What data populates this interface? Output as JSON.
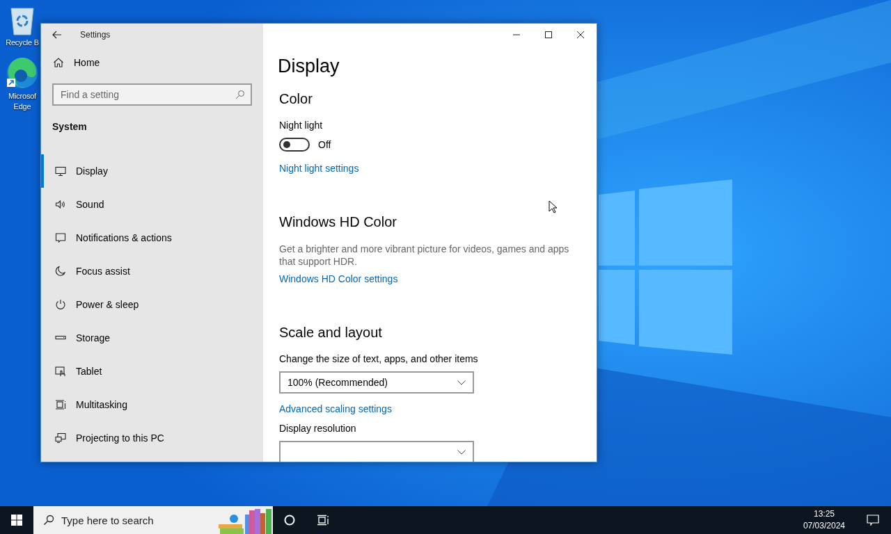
{
  "desktop_icons": [
    {
      "kind": "bin",
      "lines": [
        "Recycle B"
      ]
    },
    {
      "kind": "edge",
      "lines": [
        "Microsof",
        "Edge"
      ]
    }
  ],
  "window": {
    "title": "Settings",
    "home": "Home",
    "search": {
      "placeholder": "Find a setting"
    },
    "section": "System",
    "nav": [
      {
        "kind": "display",
        "label": "Display",
        "selected": true
      },
      {
        "kind": "sound",
        "label": "Sound",
        "selected": false
      },
      {
        "kind": "notifications",
        "label": "Notifications & actions",
        "selected": false
      },
      {
        "kind": "moon",
        "label": "Focus assist",
        "selected": false
      },
      {
        "kind": "power",
        "label": "Power & sleep",
        "selected": false
      },
      {
        "kind": "storage",
        "label": "Storage",
        "selected": false
      },
      {
        "kind": "tablet",
        "label": "Tablet",
        "selected": false
      },
      {
        "kind": "multitask",
        "label": "Multitasking",
        "selected": false
      },
      {
        "kind": "project",
        "label": "Projecting to this PC",
        "selected": false
      }
    ],
    "page_title": "Display",
    "blocks": [
      {
        "kind": "heading",
        "text": "Color"
      },
      {
        "kind": "label",
        "text": "Night light"
      },
      {
        "kind": "toggle",
        "on": false,
        "text": "Off"
      },
      {
        "kind": "link",
        "text": "Night light settings"
      },
      {
        "kind": "heading",
        "text": "Windows HD Color"
      },
      {
        "kind": "paragraph",
        "text": "Get a brighter and more vibrant picture for videos, games and apps that support HDR."
      },
      {
        "kind": "link",
        "text": "Windows HD Color settings"
      },
      {
        "kind": "heading",
        "text": "Scale and layout"
      },
      {
        "kind": "label",
        "text": "Change the size of text, apps, and other items"
      },
      {
        "kind": "dropdown",
        "value": "100% (Recommended)"
      },
      {
        "kind": "link",
        "text": "Advanced scaling settings"
      },
      {
        "kind": "label",
        "text": "Display resolution"
      },
      {
        "kind": "dropdown"
      }
    ]
  },
  "taskbar": {
    "search": {
      "placeholder": "Type here to search"
    },
    "time": "13:25",
    "date": "07/03/2024"
  }
}
